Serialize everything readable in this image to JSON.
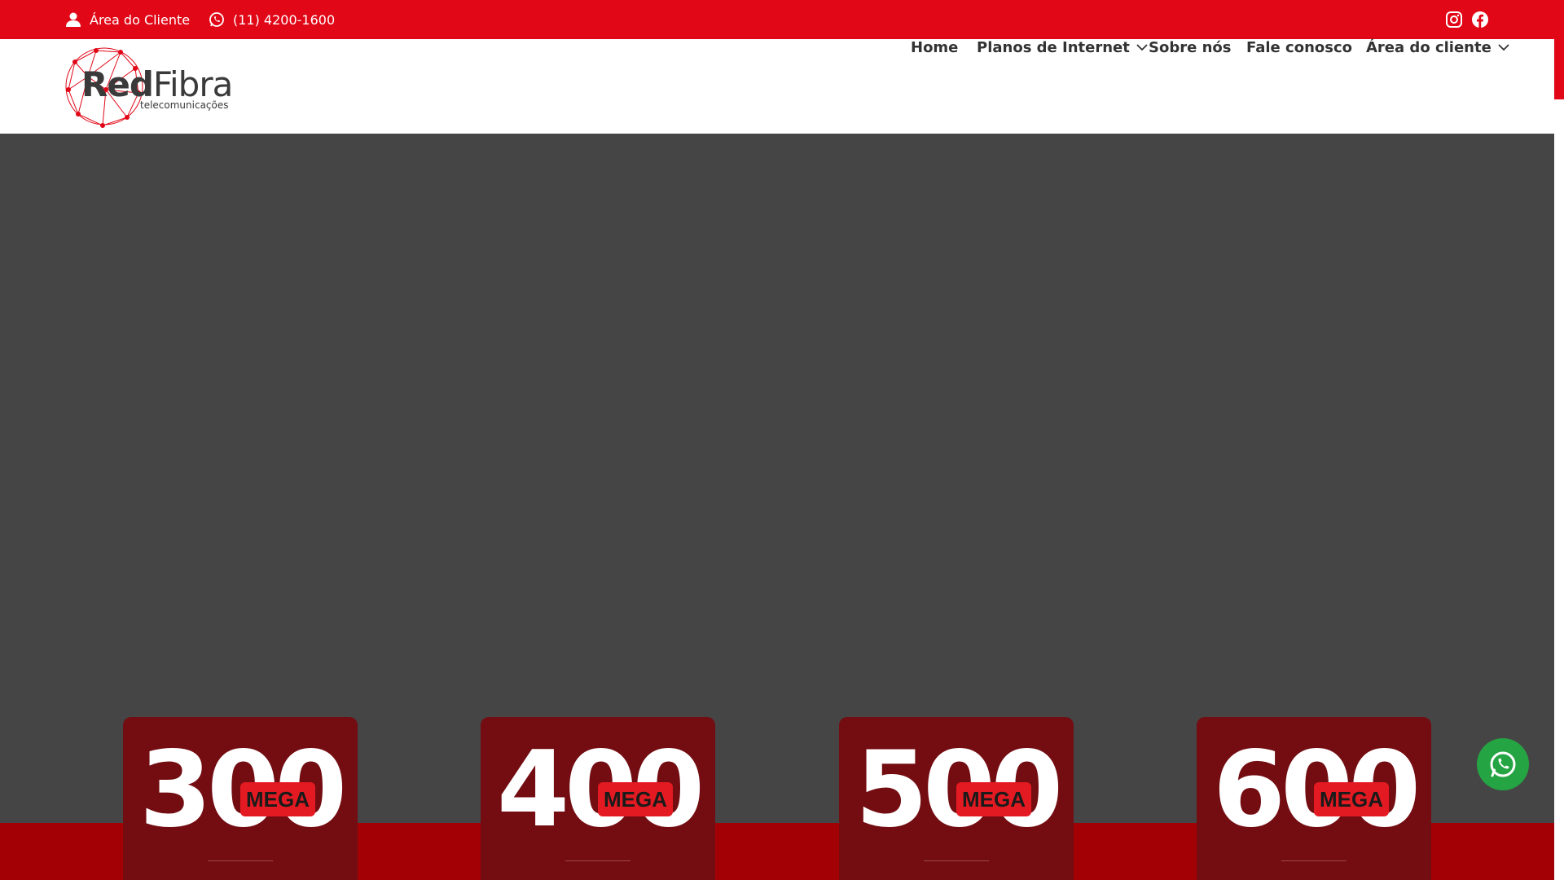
{
  "topbar": {
    "client_area": "Área do Cliente",
    "phone": "(11) 4200-1600",
    "social": [
      "instagram-icon",
      "facebook-icon"
    ],
    "bg_color": "#e10717"
  },
  "logo": {
    "name_bold": "Red",
    "name_regular": "Fibra",
    "tagline": "telecomunicações"
  },
  "nav": {
    "items": [
      {
        "label": "Home",
        "dropdown": false
      },
      {
        "label": "Planos de Internet",
        "dropdown": true
      },
      {
        "label": "Sobre nós",
        "dropdown": false
      },
      {
        "label": "Fale conosco",
        "dropdown": false
      },
      {
        "label": "Área do cliente",
        "dropdown": true
      }
    ]
  },
  "plans": [
    {
      "speed": "300",
      "unit": "MEGA"
    },
    {
      "speed": "400",
      "unit": "MEGA"
    },
    {
      "speed": "500",
      "unit": "MEGA"
    },
    {
      "speed": "600",
      "unit": "MEGA"
    }
  ],
  "colors": {
    "brand_red": "#e10717",
    "card_bg": "#730d12",
    "band_red": "#a30005",
    "hero_bg": "#454545",
    "whatsapp_green": "#25a443"
  }
}
